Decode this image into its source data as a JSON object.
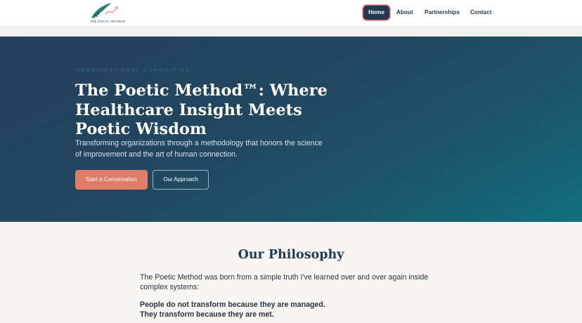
{
  "header": {
    "logo_text": "THE POETIC METHOD",
    "nav": [
      {
        "label": "Home",
        "active": true
      },
      {
        "label": "About"
      },
      {
        "label": "Partnerships"
      },
      {
        "label": "Contact"
      }
    ]
  },
  "hero": {
    "eyebrow": "ORGANIZATIONAL CONSULTING",
    "title": "The Poetic Method™: Where Healthcare Insight Meets Poetic Wisdom",
    "subtitle": "Transforming organizations through a methodology that honors the science of improvement and the art of human connection.",
    "primary_button": "Start a Conversation",
    "secondary_button": "Our Approach"
  },
  "philosophy": {
    "title": "Our Philosophy",
    "body": "The Poetic Method was born from a simple truth I've learned over and over again inside complex systems:",
    "bold_line_1": "People do not transform because they are managed.",
    "bold_line_2": "They transform because they are met."
  },
  "colors": {
    "navy": "#1f3a52",
    "accent_coral": "#e07d68",
    "active_outline": "#e06a63",
    "teal": "#0f6f7e"
  },
  "icons": [
    "feather-quill-icon",
    "growth-line-icon"
  ]
}
